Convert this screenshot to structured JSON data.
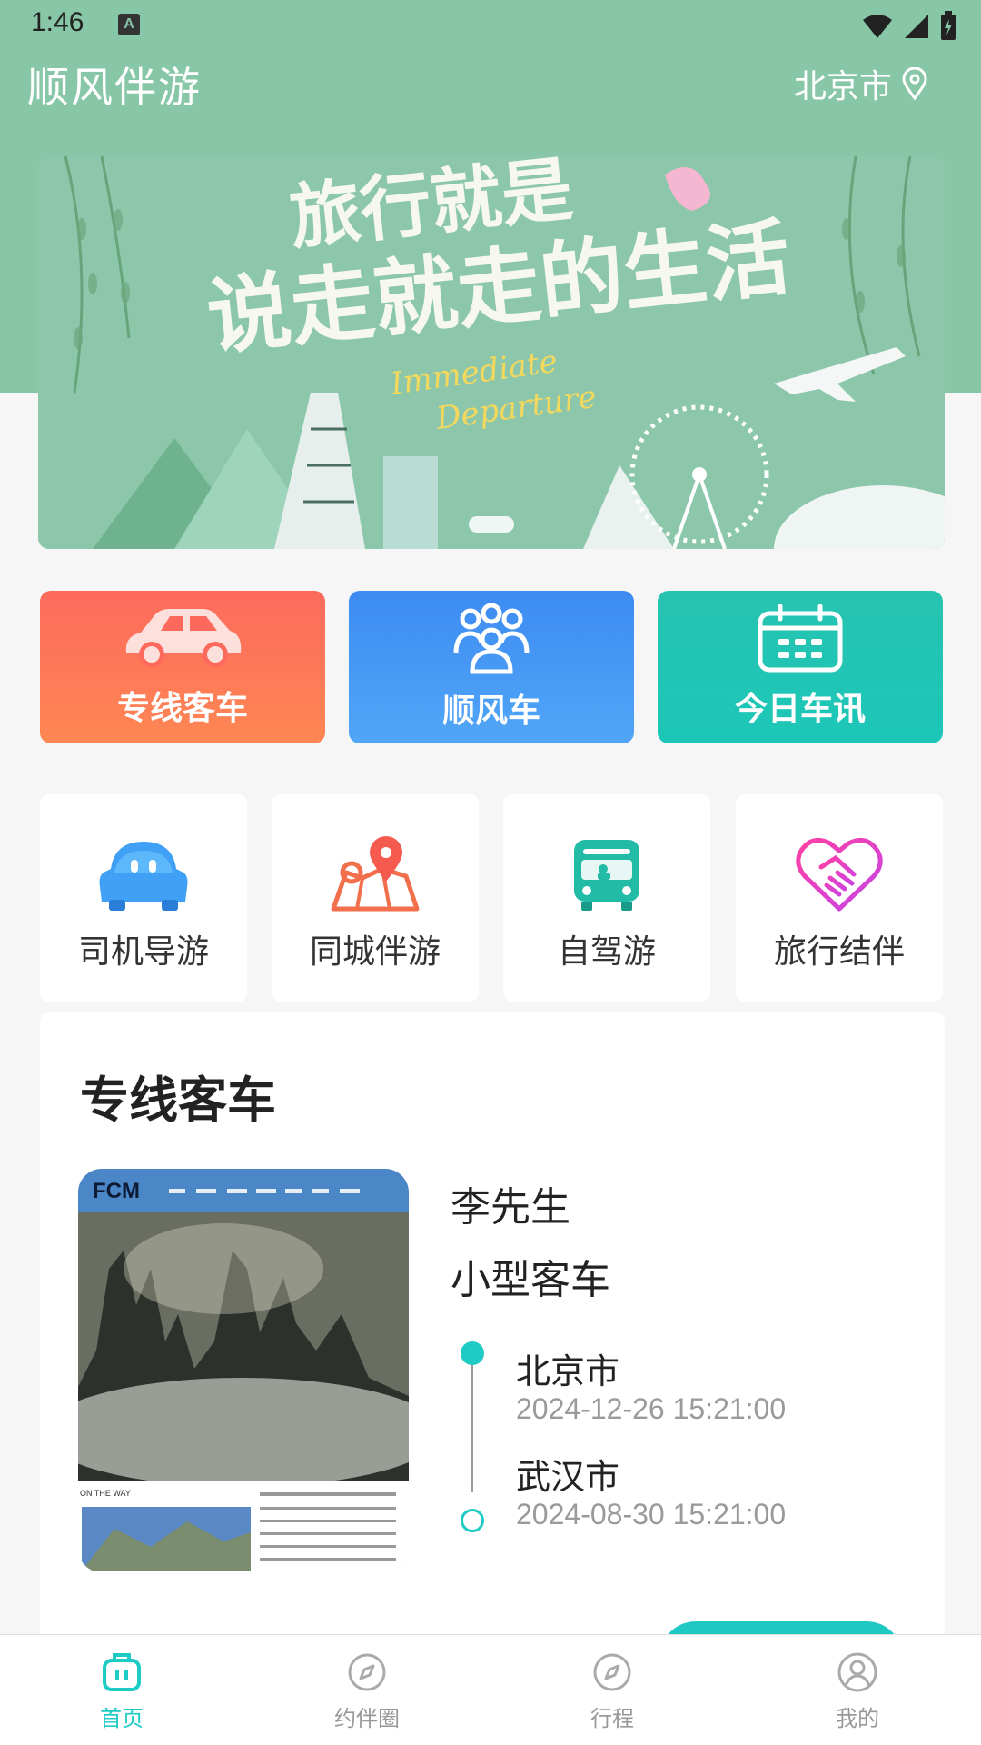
{
  "status": {
    "time": "1:46",
    "notification_badge": "A"
  },
  "header": {
    "title": "顺风伴游",
    "city": "北京市"
  },
  "banner": {
    "line1": "旅行就是",
    "line2": "说走就走的生活",
    "sub1": "Immediate",
    "sub2": "Departure"
  },
  "big_services": [
    {
      "label": "专线客车",
      "icon": "car-icon",
      "color": "#fd6a5d"
    },
    {
      "label": "顺风车",
      "icon": "group-icon",
      "color": "#3d8bf2"
    },
    {
      "label": "今日车讯",
      "icon": "calendar-icon",
      "color": "#27c3b0"
    }
  ],
  "small_services": [
    {
      "label": "司机导游",
      "icon": "driver-car-icon"
    },
    {
      "label": "同城伴游",
      "icon": "map-pin-icon"
    },
    {
      "label": "自驾游",
      "icon": "bus-icon"
    },
    {
      "label": "旅行结伴",
      "icon": "heart-handshake-icon"
    }
  ],
  "section": {
    "title": "专线客车",
    "listing": {
      "driver": "李先生",
      "vehicle": "小型客车",
      "from_city": "北京市",
      "from_time": "2024-12-26 15:21:00",
      "to_city": "武汉市",
      "to_time": "2024-08-30 15:21:00",
      "thumb_logo": "FCM",
      "thumb_caption": "ON THE WAY"
    }
  },
  "nav": [
    {
      "label": "首页",
      "icon": "home-bag-icon",
      "active": true
    },
    {
      "label": "约伴圈",
      "icon": "compass-icon",
      "active": false
    },
    {
      "label": "行程",
      "icon": "compass-icon",
      "active": false
    },
    {
      "label": "我的",
      "icon": "user-icon",
      "active": false
    }
  ],
  "colors": {
    "accent": "#1ecbc5",
    "header_bg": "#88c6a8"
  }
}
